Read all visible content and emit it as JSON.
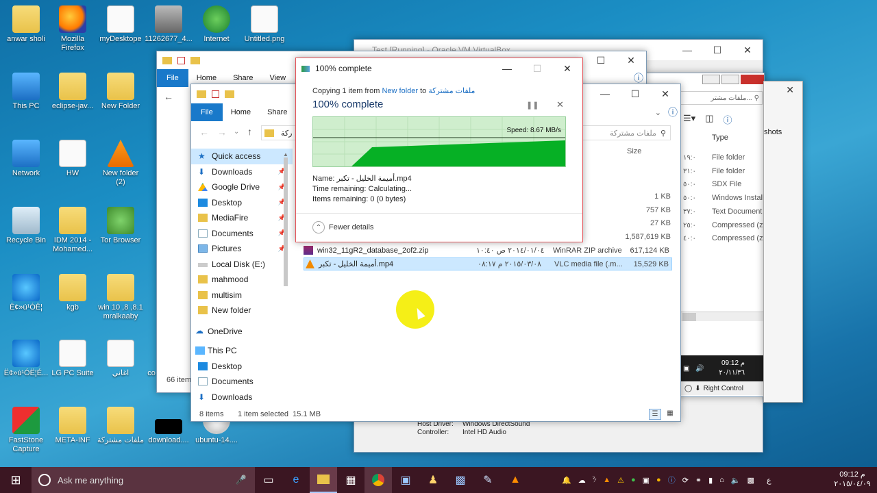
{
  "desktop": {
    "icons": [
      {
        "label": "anwar sholi",
        "kind": "user"
      },
      {
        "label": "Mozilla Firefox",
        "kind": "firefox"
      },
      {
        "label": "myDesktope",
        "kind": "file"
      },
      {
        "label": "11262677_4...",
        "kind": "image"
      },
      {
        "label": "Internet",
        "kind": "idm"
      },
      {
        "label": "Untitled.png",
        "kind": "image"
      },
      {
        "label": "This PC",
        "kind": "pc"
      },
      {
        "label": "eclipse-jav...",
        "kind": "folder"
      },
      {
        "label": "New Folder",
        "kind": "folder"
      },
      {
        "label": "Network",
        "kind": "network"
      },
      {
        "label": "HW",
        "kind": "file"
      },
      {
        "label": "New folder (2)",
        "kind": "vlc"
      },
      {
        "label": "Recycle Bin",
        "kind": "bin"
      },
      {
        "label": "IDM 2014 - Mohamed...",
        "kind": "folder"
      },
      {
        "label": "Tor Browser",
        "kind": "tor"
      },
      {
        "label": "Ë¢»ú¹ÓË¦",
        "kind": "ie"
      },
      {
        "label": "kgb",
        "kind": "folder"
      },
      {
        "label": "win 10 ,8 ,8.1 mralkaaby",
        "kind": "folder"
      },
      {
        "label": "Ë¢»ú¹ÓË¦É...",
        "kind": "edge"
      },
      {
        "label": "LG PC Suite",
        "kind": "file"
      },
      {
        "label": "اغاني",
        "kind": "file"
      },
      {
        "label": "co",
        "kind": "file"
      },
      {
        "label": "FastStone Capture",
        "kind": "faststone"
      },
      {
        "label": "META-INF",
        "kind": "folder"
      },
      {
        "label": "ملفات مشتركة",
        "kind": "folder"
      },
      {
        "label": "download....",
        "kind": "black"
      },
      {
        "label": "ubuntu-14....",
        "kind": "disc"
      }
    ]
  },
  "virtualbox": {
    "title": "Test [Running] - Oracle VM VirtualBox",
    "host_driver_label": "Host Driver:",
    "host_driver_value": "Windows DirectSound",
    "controller_label": "Controller:",
    "controller_value": "Intel HD Audio",
    "vm_time": "09:12 م",
    "vm_date": "٢٠/١١/٣٦",
    "right_control": "Right Control"
  },
  "right_explorer": {
    "search_placeholder": "ملفات مشتر...",
    "type_header": "Type",
    "types": [
      "File folder",
      "File folder",
      "SDX File",
      "Windows Install...",
      "Text Document",
      "Compressed (zi...",
      "Compressed (zi..."
    ],
    "times": [
      "١٩:٠",
      "٣١:٠",
      "٥٠:٠",
      "٥٠:٠",
      "٣٧:٠",
      "٢٥:٠",
      "٤٠:٠"
    ],
    "shots_label": "shots"
  },
  "back_explorer": {
    "tab_file": "File",
    "tab_home": "Home",
    "tab_share": "Share",
    "tab_view": "View",
    "status_items": "66 item"
  },
  "explorer": {
    "tab_file": "File",
    "tab_home": "Home",
    "tab_share": "Share",
    "address_text": "ركة",
    "search_placeholder": "ملفات مشتركة",
    "col_size": "Size",
    "nav": [
      {
        "label": "Quick access",
        "icon": "star-icon"
      },
      {
        "label": "Downloads",
        "icon": "download-icon",
        "pinned": true
      },
      {
        "label": "Google Drive",
        "icon": "drive-icon",
        "pinned": true
      },
      {
        "label": "Desktop",
        "icon": "desktop-icon",
        "pinned": true
      },
      {
        "label": "MediaFire",
        "icon": "folder-icon",
        "pinned": true
      },
      {
        "label": "Documents",
        "icon": "documents-icon",
        "pinned": true
      },
      {
        "label": "Pictures",
        "icon": "pictures-icon",
        "pinned": true
      },
      {
        "label": "Local Disk (E:)",
        "icon": "drive-disk-icon"
      },
      {
        "label": "mahmood",
        "icon": "folder-icon"
      },
      {
        "label": "multisim",
        "icon": "folder-icon"
      },
      {
        "label": "New folder",
        "icon": "folder-icon"
      },
      {
        "label": "OneDrive",
        "icon": "cloud-icon"
      },
      {
        "label": "This PC",
        "icon": "pc-icon"
      },
      {
        "label": "Desktop",
        "icon": "desktop-icon"
      },
      {
        "label": "Documents",
        "icon": "documents-icon"
      },
      {
        "label": "Downloads",
        "icon": "download-icon"
      }
    ],
    "partial_rows": [
      {
        "type": "wnload ...",
        "size": "1 KB"
      },
      {
        "type": "Installer ...",
        "size": "757 KB"
      },
      {
        "type": "ment",
        "size": "27 KB"
      },
      {
        "type": "ZIP archive",
        "size": "1,587,619 KB"
      }
    ],
    "files": [
      {
        "name": "win32_11gR2_database_2of2.zip",
        "date": "٢٠١٤/٠١/٠٤ ص ١٠:٤٠",
        "type": "WinRAR ZIP archive",
        "size": "617,124 KB",
        "selected": false
      },
      {
        "name": "أميمة الخليل - تكبر.mp4",
        "date": "٢٠١٥/٠٣/٠٨ م ٠٨:١٧",
        "type": "VLC media file (.m...",
        "size": "15,529 KB",
        "selected": true
      }
    ],
    "status_count": "8 items",
    "status_selected": "1 item selected  15.1 MB"
  },
  "copy_dialog": {
    "title": "100% complete",
    "copying_prefix": "Copying 1 item from ",
    "source": "New folder",
    "to": " to ",
    "dest": "ملفات مشتركة",
    "heading": "100% complete",
    "speed": "Speed: 8.67 MB/s",
    "progress_fraction": 1.0,
    "name_label": "Name:",
    "name_value": "أميمة الخليل - تكبر.mp4",
    "time_label": "Time remaining:",
    "time_value": "Calculating...",
    "items_label": "Items remaining:",
    "items_value": "0 (0 bytes)",
    "fewer_details": "Fewer details"
  },
  "taskbar": {
    "search_placeholder": "Ask me anything",
    "clock_time": "09:12 م",
    "clock_date": "٢٠١٥/٠٤/٠٩",
    "lang": "ع"
  },
  "colors": {
    "taskbar": "#3b1622",
    "accent": "#1979ca",
    "progress_green": "#06b025",
    "selection": "#cce8ff"
  }
}
